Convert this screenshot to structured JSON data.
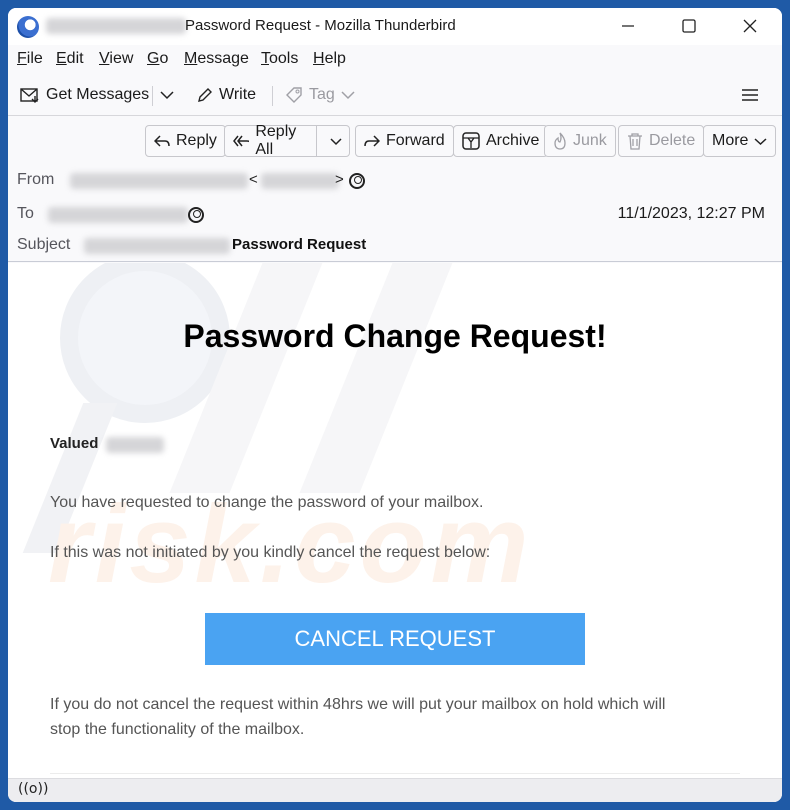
{
  "window": {
    "title": "Password Request - Mozilla Thunderbird",
    "controls": {
      "minimize": "minimize",
      "maximize": "maximize",
      "close": "close"
    }
  },
  "menubar": {
    "items": [
      {
        "label": "File",
        "accel": "F",
        "rest": "ile"
      },
      {
        "label": "Edit",
        "accel": "E",
        "rest": "dit"
      },
      {
        "label": "View",
        "accel": "V",
        "rest": "iew"
      },
      {
        "label": "Go",
        "accel": "G",
        "rest": "o"
      },
      {
        "label": "Message",
        "accel": "M",
        "rest": "essage"
      },
      {
        "label": "Tools",
        "accel": "T",
        "rest": "ools"
      },
      {
        "label": "Help",
        "accel": "H",
        "rest": "elp"
      }
    ]
  },
  "toolbar": {
    "get_messages": "Get Messages",
    "write": "Write",
    "tag": "Tag"
  },
  "header": {
    "buttons": {
      "reply": "Reply",
      "reply_all": "Reply All",
      "forward": "Forward",
      "archive": "Archive",
      "junk": "Junk",
      "delete": "Delete",
      "more": "More"
    },
    "from_label": "From",
    "to_label": "To",
    "subject_label": "Subject",
    "subject": "Password Request",
    "date": "11/1/2023, 12:27 PM",
    "lt": "<",
    "gt": ">"
  },
  "email": {
    "title": "Password Change Request!",
    "greeting": "Valued",
    "para1": "You have requested to change the password of your mailbox.",
    "para2": "If this was not initiated by you kindly cancel the request below:",
    "cta": "CANCEL REQUEST",
    "para3_line1": "If you do not cancel the request within 48hrs we will put your mailbox on hold which will",
    "para3_line2": "stop the functionality of the mailbox.",
    "cta_color": "#4aa3f2"
  },
  "watermark": {
    "text": "risk.com"
  },
  "statusbar": {
    "icon": "((o))"
  }
}
